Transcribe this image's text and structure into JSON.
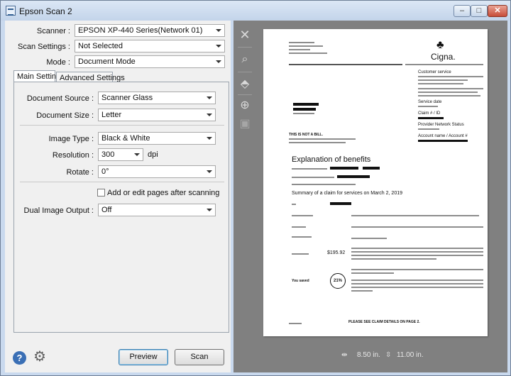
{
  "window": {
    "title": "Epson Scan 2"
  },
  "scanner": {
    "label": "Scanner :",
    "value": "EPSON XP-440 Series(Network 01)"
  },
  "scan_settings": {
    "label": "Scan Settings :",
    "value": "Not Selected"
  },
  "mode": {
    "label": "Mode :",
    "value": "Document Mode"
  },
  "tabs": [
    {
      "label": "Main Settings"
    },
    {
      "label": "Advanced Settings"
    }
  ],
  "main": {
    "document_source": {
      "label": "Document Source :",
      "value": "Scanner Glass"
    },
    "document_size": {
      "label": "Document Size :",
      "value": "Letter"
    },
    "image_type": {
      "label": "Image Type :",
      "value": "Black & White"
    },
    "resolution": {
      "label": "Resolution :",
      "value": "300",
      "unit": "dpi"
    },
    "rotate": {
      "label": "Rotate :",
      "value": "0°"
    },
    "add_pages": {
      "label": "Add or edit pages after scanning",
      "checked": false
    },
    "dual_image": {
      "label": "Dual Image Output :",
      "value": "Off"
    }
  },
  "buttons": {
    "preview": "Preview",
    "scan": "Scan"
  },
  "preview": {
    "width_readout": "8.50 in.",
    "height_readout": "11.00 in.",
    "doc": {
      "brand": "Cigna.",
      "not_a_bill": "THIS IS NOT A BILL.",
      "eob_title": "Explanation of benefits",
      "summary": "Summary of a claim for services on March 2, 2019",
      "amount": "$195.92",
      "percent": "21%",
      "you_saved": "You saved",
      "footer": "PLEASE SEE CLAIM DETAILS ON PAGE 2.",
      "customer_service": "Customer service",
      "service_date": "Service date",
      "claim_id": "Claim # / ID",
      "provider_status": "Provider Network Status",
      "account_name": "Account name / Account #"
    }
  },
  "icons": {
    "close": "close-icon",
    "zoom": "magnifier-icon",
    "tag": "tag-icon",
    "add": "add-page-icon",
    "pages": "pages-icon",
    "help": "help-icon",
    "settings": "gear-icon",
    "width": "width-icon",
    "height": "height-icon"
  }
}
